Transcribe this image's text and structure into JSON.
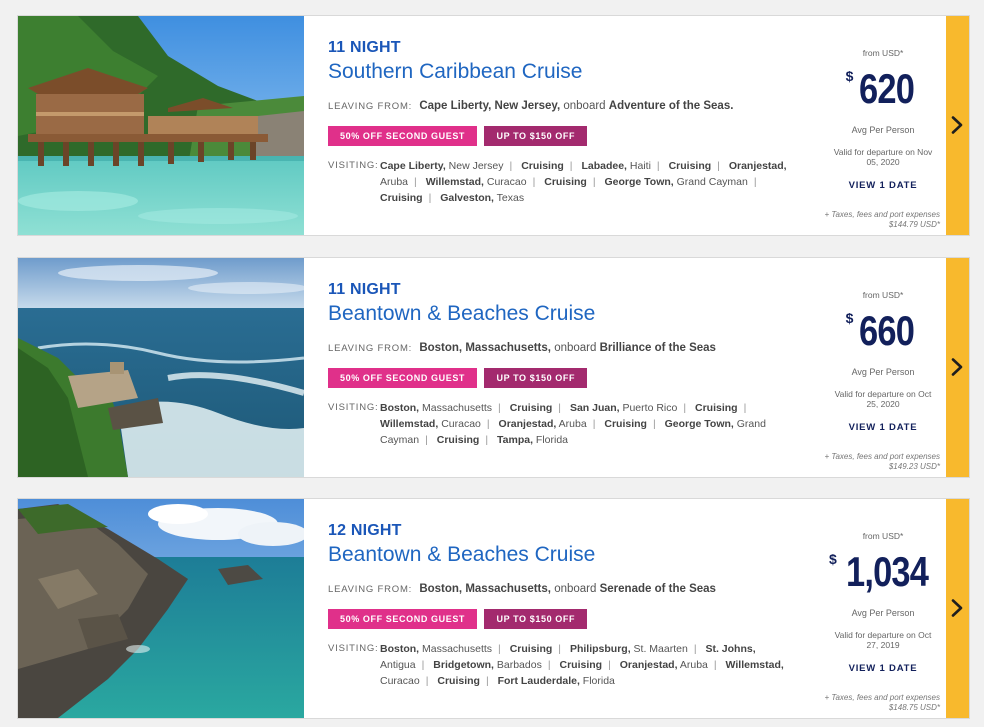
{
  "cards": [
    {
      "nights": "11 NIGHT",
      "title": "Southern Caribbean Cruise",
      "leaving_label": "LEAVING FROM:",
      "leaving_port": "Cape Liberty, New Jersey,",
      "onboard_text": "onboard",
      "ship": "Adventure of the Seas.",
      "badge1": "50% OFF SECOND GUEST",
      "badge2": "UP TO $150 OFF",
      "visiting_label": "VISITING:",
      "ports": [
        {
          "name": "Cape Liberty,",
          "region": "New Jersey"
        },
        {
          "name": "Cruising",
          "region": ""
        },
        {
          "name": "Labadee,",
          "region": "Haiti"
        },
        {
          "name": "Cruising",
          "region": ""
        },
        {
          "name": "Oranjestad,",
          "region": "Aruba"
        },
        {
          "name": "Willemstad,",
          "region": "Curacao"
        },
        {
          "name": "Cruising",
          "region": ""
        },
        {
          "name": "George Town,",
          "region": "Grand Cayman"
        },
        {
          "name": "Cruising",
          "region": ""
        },
        {
          "name": "Galveston,",
          "region": "Texas"
        }
      ],
      "from_text": "from USD*",
      "currency_symbol": "$",
      "price": "620",
      "avg_text": "Avg Per Person",
      "valid_text": "Valid for departure on Nov 05, 2020",
      "view_text": "VIEW 1 DATE",
      "taxes_text": "+ Taxes, fees and port expenses $144.79 USD*"
    },
    {
      "nights": "11 NIGHT",
      "title": "Beantown & Beaches Cruise",
      "leaving_label": "LEAVING FROM:",
      "leaving_port": "Boston, Massachusetts,",
      "onboard_text": "onboard",
      "ship": "Brilliance of the Seas",
      "badge1": "50% OFF SECOND GUEST",
      "badge2": "UP TO $150 OFF",
      "visiting_label": "VISITING:",
      "ports": [
        {
          "name": "Boston,",
          "region": "Massachusetts"
        },
        {
          "name": "Cruising",
          "region": ""
        },
        {
          "name": "San Juan,",
          "region": "Puerto Rico"
        },
        {
          "name": "Cruising",
          "region": ""
        },
        {
          "name": "Willemstad,",
          "region": "Curacao"
        },
        {
          "name": "Oranjestad,",
          "region": "Aruba"
        },
        {
          "name": "Cruising",
          "region": ""
        },
        {
          "name": "George Town,",
          "region": "Grand Cayman"
        },
        {
          "name": "Cruising",
          "region": ""
        },
        {
          "name": "Tampa,",
          "region": "Florida"
        }
      ],
      "from_text": "from USD*",
      "currency_symbol": "$",
      "price": "660",
      "avg_text": "Avg Per Person",
      "valid_text": "Valid for departure on Oct 25, 2020",
      "view_text": "VIEW 1 DATE",
      "taxes_text": "+ Taxes, fees and port expenses $149.23 USD*"
    },
    {
      "nights": "12 NIGHT",
      "title": "Beantown & Beaches Cruise",
      "leaving_label": "LEAVING FROM:",
      "leaving_port": "Boston, Massachusetts,",
      "onboard_text": "onboard",
      "ship": "Serenade of the Seas",
      "badge1": "50% OFF SECOND GUEST",
      "badge2": "UP TO $150 OFF",
      "visiting_label": "VISITING:",
      "ports": [
        {
          "name": "Boston,",
          "region": "Massachusetts"
        },
        {
          "name": "Cruising",
          "region": ""
        },
        {
          "name": "Philipsburg,",
          "region": "St. Maarten"
        },
        {
          "name": "St. Johns,",
          "region": "Antigua"
        },
        {
          "name": "Bridgetown,",
          "region": "Barbados"
        },
        {
          "name": "Cruising",
          "region": ""
        },
        {
          "name": "Oranjestad,",
          "region": "Aruba"
        },
        {
          "name": "Willemstad,",
          "region": "Curacao"
        },
        {
          "name": "Cruising",
          "region": ""
        },
        {
          "name": "Fort Lauderdale,",
          "region": "Florida"
        }
      ],
      "from_text": "from USD*",
      "currency_symbol": "$",
      "price": "1,034",
      "avg_text": "Avg Per Person",
      "valid_text": "Valid for departure on Oct 27, 2019",
      "view_text": "VIEW 1 DATE",
      "taxes_text": "+ Taxes, fees and port expenses $148.75 USD*"
    }
  ],
  "colors": {
    "title_blue": "#1f66c1",
    "badge_pink": "#e0308a",
    "badge_plum": "#a32a6e",
    "price_navy": "#12205b",
    "tab_yellow": "#f8b92d"
  },
  "icons": {
    "tab_arrow": "chevron-right-icon"
  }
}
